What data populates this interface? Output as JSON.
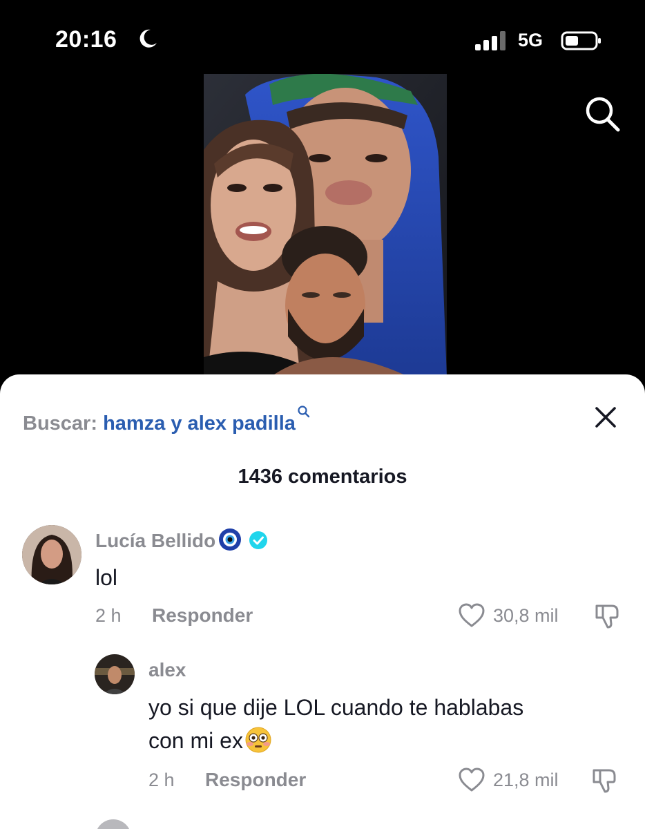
{
  "status_bar": {
    "time": "20:16",
    "network": "5G",
    "icons": [
      "moon-icon",
      "signal-icon",
      "battery-icon"
    ]
  },
  "top_bar": {
    "search_icon": "search-icon"
  },
  "comments_sheet": {
    "search_prefix": "Buscar:",
    "search_query": "hamza y alex padilla",
    "close_icon": "close-icon",
    "comment_count": "1436 comentarios",
    "comments": [
      {
        "username": "Lucía Bellido",
        "badges": [
          "nazar-eye-emoji",
          "verified-icon"
        ],
        "text": "lol",
        "time": "2 h",
        "reply_label": "Responder",
        "likes": "30,8 mil"
      }
    ],
    "replies": [
      {
        "username": "alex",
        "text_line1": "yo si que dije LOL cuando te hablabas",
        "text_line2": "con mi ex",
        "emoji": "flushed-face-emoji",
        "time": "2 h",
        "reply_label": "Responder",
        "likes": "21,8 mil"
      }
    ]
  },
  "colors": {
    "accent_link": "#2a5db0",
    "muted_text": "#8a8b91",
    "primary_text": "#161823",
    "verified": "#20d5ec"
  }
}
